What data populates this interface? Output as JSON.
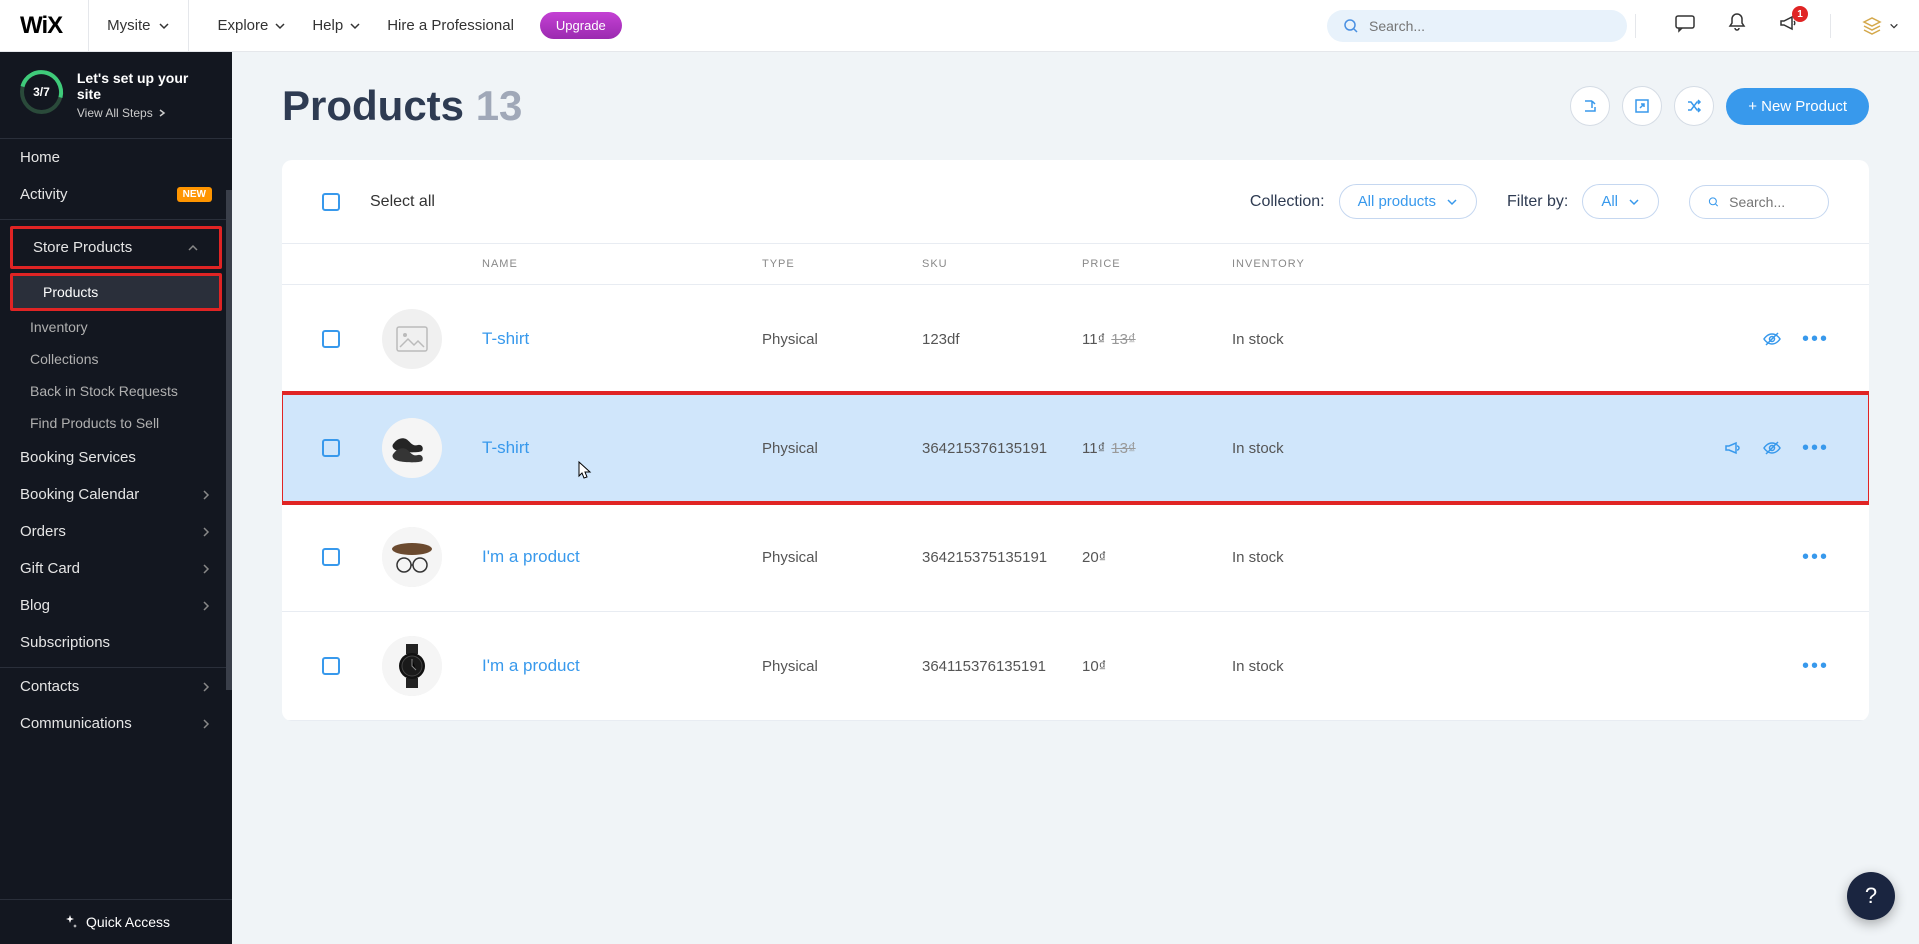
{
  "topbar": {
    "logo": "WiX",
    "site_name": "Mysite",
    "nav": {
      "explore": "Explore",
      "help": "Help",
      "hire": "Hire a Professional"
    },
    "upgrade": "Upgrade",
    "search_placeholder": "Search...",
    "notification_count": "1"
  },
  "sidebar": {
    "progress": "3/7",
    "setup_title": "Let's set up your site",
    "view_steps": "View All Steps",
    "items": {
      "home": "Home",
      "activity": "Activity",
      "activity_badge": "NEW",
      "store_products": "Store Products",
      "products": "Products",
      "inventory": "Inventory",
      "collections": "Collections",
      "back_in_stock": "Back in Stock Requests",
      "find_products": "Find Products to Sell",
      "booking_services": "Booking Services",
      "booking_calendar": "Booking Calendar",
      "orders": "Orders",
      "gift_card": "Gift Card",
      "blog": "Blog",
      "subscriptions": "Subscriptions",
      "contacts": "Contacts",
      "communications": "Communications"
    },
    "quick_access": "Quick Access"
  },
  "page": {
    "title": "Products",
    "count": "13",
    "new_product": "+ New Product"
  },
  "toolbar": {
    "select_all": "Select all",
    "collection_label": "Collection:",
    "collection_value": "All products",
    "filter_label": "Filter by:",
    "filter_value": "All",
    "search_placeholder": "Search..."
  },
  "columns": {
    "name": "NAME",
    "type": "TYPE",
    "sku": "SKU",
    "price": "PRICE",
    "inventory": "INVENTORY"
  },
  "rows": [
    {
      "name": "T-shirt",
      "type": "Physical",
      "sku": "123df",
      "price": "11₫",
      "old_price": "13₫",
      "inventory": "In stock",
      "thumb": "placeholder",
      "eye_off": true
    },
    {
      "name": "T-shirt",
      "type": "Physical",
      "sku": "364215376135191",
      "price": "11₫",
      "old_price": "13₫",
      "inventory": "In stock",
      "thumb": "shoes",
      "eye_off": true,
      "promo": true,
      "highlighted": true
    },
    {
      "name": "I'm a product",
      "type": "Physical",
      "sku": "364215375135191",
      "price": "20₫",
      "old_price": "",
      "inventory": "In stock",
      "thumb": "glasses"
    },
    {
      "name": "I'm a product",
      "type": "Physical",
      "sku": "364115376135191",
      "price": "10₫",
      "old_price": "",
      "inventory": "In stock",
      "thumb": "watch"
    }
  ]
}
